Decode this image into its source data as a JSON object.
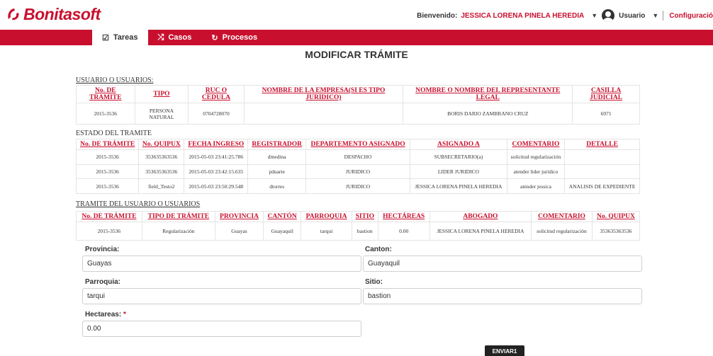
{
  "brand": {
    "name": "Bonitasoft",
    "color": "#c8102e"
  },
  "header": {
    "welcome_label": "Bienvenido:",
    "user_name": "JESSICA LORENA PINELA HEREDIA",
    "user_menu_label": "Usuario",
    "settings_label": "Configuració"
  },
  "nav": {
    "tabs": [
      {
        "label": "Tareas",
        "icon": "checkbox-icon",
        "active": true
      },
      {
        "label": "Casos",
        "icon": "shuffle-icon",
        "active": false
      },
      {
        "label": "Procesos",
        "icon": "process-icon",
        "active": false
      }
    ]
  },
  "page": {
    "title": "MODIFICAR TRÁMITE"
  },
  "section_users": {
    "label": "USUARIO O USUARIOS:",
    "columns": [
      "No. DE TRAMITE",
      "TIPO",
      "RUC O CEDULA",
      "NOMBRE DE LA EMPRESA(SI ES TIPO JURIDICO)",
      "NOMBRE O NOMBRE DEL REPRESENTANTE LEGAL",
      "CASILLA JUDICIAL"
    ],
    "rows": [
      [
        "2015-3536",
        "PERSONA NATURAL",
        "0704728070",
        "",
        "BORIS DARIO ZAMBRANO CRUZ",
        "6971"
      ]
    ]
  },
  "section_status": {
    "label": "ESTADO DEL TRAMITE",
    "columns": [
      "No. DE TRÁMITE",
      "No. QUIPUX",
      "FECHA INGRESO",
      "REGISTRADOR",
      "DEPARTEMENTO ASIGNADO",
      "ASIGNADO A",
      "COMENTARIO",
      "DETALLE"
    ],
    "rows": [
      [
        "2015-3536",
        "353635363536",
        "2015-05-03 23:41:25.786",
        "dmedina",
        "DESPACHO",
        "SUBSECRETARIO(a)",
        "solicitud regularización",
        ""
      ],
      [
        "2015-3536",
        "353635363536",
        "2015-05-03 23:42:15.635",
        "pduarte",
        "JURIDICO",
        "LIDER JURIDICO",
        "atender lider juridico",
        ""
      ],
      [
        "2015-3536",
        "field_Testo2",
        "2015-05-03 23:50:29.548",
        "dtorres",
        "JURIDICO",
        "JESSICA LORENA PINELA HEREDIA",
        "atender jessica",
        "ANALISIS DE EXPEDIENTE"
      ]
    ]
  },
  "section_user_procedure": {
    "label": "TRAMITE DEL USUARIO O USUARIOS",
    "columns": [
      "No. DE TRÁMITE",
      "TIPO DE TRÁMITE",
      "PROVINCIA",
      "CANTÓN",
      "PARROQUIA",
      "SITIO",
      "HECTÁREAS",
      "ABOGADO",
      "COMENTARIO",
      "No. QUIPUX"
    ],
    "rows": [
      [
        "2015-3536",
        "Regularización",
        "Guayas",
        "Guayaquil",
        "tarqui",
        "bastion",
        "0.00",
        "JESSICA LORENA PINELA HEREDIA",
        "solicitud regularización",
        "353635363536"
      ]
    ]
  },
  "form": {
    "provincia": {
      "label": "Provincia:",
      "value": "Guayas"
    },
    "canton": {
      "label": "Canton:",
      "value": "Guayaquil"
    },
    "parroquia": {
      "label": "Parroquia:",
      "value": "tarqui"
    },
    "sitio": {
      "label": "Sitio:",
      "value": "bastion"
    },
    "hectareas": {
      "label": "Hectareas:",
      "required_mark": "*",
      "value": "0.00"
    }
  },
  "actions": {
    "submit_label": "ENVIAR1"
  }
}
